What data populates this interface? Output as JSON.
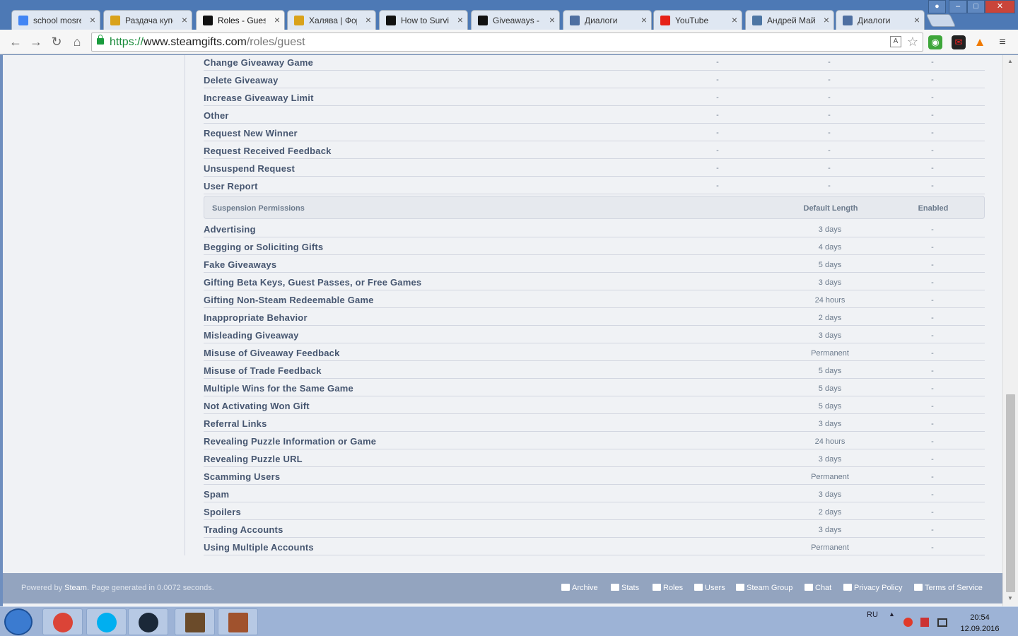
{
  "browser": {
    "tabs": [
      {
        "title": "school mosreg",
        "icon": "google-icon",
        "color": "#4285f4"
      },
      {
        "title": "Раздача купо",
        "icon": "forum-icon",
        "color": "#d9a21b"
      },
      {
        "title": "Roles - Guest",
        "icon": "steamgifts-icon",
        "color": "#111111"
      },
      {
        "title": "Халява | Фору",
        "icon": "forum-icon",
        "color": "#d9a21b"
      },
      {
        "title": "How to Surviv",
        "icon": "steamgifts-icon",
        "color": "#111111"
      },
      {
        "title": "Giveaways - W",
        "icon": "steamgifts-icon",
        "color": "#111111"
      },
      {
        "title": "Диалоги",
        "icon": "chat-icon",
        "color": "#4e6fa1"
      },
      {
        "title": "YouTube",
        "icon": "youtube-icon",
        "color": "#e62117"
      },
      {
        "title": "Андрей Майс",
        "icon": "vk-icon",
        "color": "#4c75a3"
      },
      {
        "title": "Диалоги",
        "icon": "chat-icon",
        "color": "#4e6fa1"
      }
    ],
    "url": {
      "scheme": "https://",
      "host": "www.steamgifts.com",
      "path": "/roles/guest"
    }
  },
  "action_rows": [
    {
      "name": "Change Giveaway Game",
      "c1": "-",
      "c2": "-",
      "c3": "-"
    },
    {
      "name": "Delete Giveaway",
      "c1": "-",
      "c2": "-",
      "c3": "-"
    },
    {
      "name": "Increase Giveaway Limit",
      "c1": "-",
      "c2": "-",
      "c3": "-"
    },
    {
      "name": "Other",
      "c1": "-",
      "c2": "-",
      "c3": "-"
    },
    {
      "name": "Request New Winner",
      "c1": "-",
      "c2": "-",
      "c3": "-"
    },
    {
      "name": "Request Received Feedback",
      "c1": "-",
      "c2": "-",
      "c3": "-"
    },
    {
      "name": "Unsuspend Request",
      "c1": "-",
      "c2": "-",
      "c3": "-"
    },
    {
      "name": "User Report",
      "c1": "-",
      "c2": "-",
      "c3": "-"
    }
  ],
  "suspension_header": {
    "title": "Suspension Permissions",
    "length": "Default Length",
    "enabled": "Enabled"
  },
  "suspension_rows": [
    {
      "name": "Advertising",
      "length": "3 days",
      "enabled": "-"
    },
    {
      "name": "Begging or Soliciting Gifts",
      "length": "4 days",
      "enabled": "-"
    },
    {
      "name": "Fake Giveaways",
      "length": "5 days",
      "enabled": "-"
    },
    {
      "name": "Gifting Beta Keys, Guest Passes, or Free Games",
      "length": "3 days",
      "enabled": "-"
    },
    {
      "name": "Gifting Non-Steam Redeemable Game",
      "length": "24 hours",
      "enabled": "-"
    },
    {
      "name": "Inappropriate Behavior",
      "length": "2 days",
      "enabled": "-"
    },
    {
      "name": "Misleading Giveaway",
      "length": "3 days",
      "enabled": "-"
    },
    {
      "name": "Misuse of Giveaway Feedback",
      "length": "Permanent",
      "enabled": "-"
    },
    {
      "name": "Misuse of Trade Feedback",
      "length": "5 days",
      "enabled": "-"
    },
    {
      "name": "Multiple Wins for the Same Game",
      "length": "5 days",
      "enabled": "-"
    },
    {
      "name": "Not Activating Won Gift",
      "length": "5 days",
      "enabled": "-"
    },
    {
      "name": "Referral Links",
      "length": "3 days",
      "enabled": "-"
    },
    {
      "name": "Revealing Puzzle Information or Game",
      "length": "24 hours",
      "enabled": "-"
    },
    {
      "name": "Revealing Puzzle URL",
      "length": "3 days",
      "enabled": "-"
    },
    {
      "name": "Scamming Users",
      "length": "Permanent",
      "enabled": "-"
    },
    {
      "name": "Spam",
      "length": "3 days",
      "enabled": "-"
    },
    {
      "name": "Spoilers",
      "length": "2 days",
      "enabled": "-"
    },
    {
      "name": "Trading Accounts",
      "length": "3 days",
      "enabled": "-"
    },
    {
      "name": "Using Multiple Accounts",
      "length": "Permanent",
      "enabled": "-"
    }
  ],
  "footer": {
    "powered_prefix": "Powered by ",
    "powered_link": "Steam",
    "generated": ". Page generated in 0.0072 seconds.",
    "links": [
      {
        "label": "Archive",
        "icon": "folder-icon"
      },
      {
        "label": "Stats",
        "icon": "bar-chart-icon"
      },
      {
        "label": "Roles",
        "icon": "wrench-icon"
      },
      {
        "label": "Users",
        "icon": "user-icon"
      },
      {
        "label": "Steam Group",
        "icon": "steam-icon"
      },
      {
        "label": "Chat",
        "icon": "megaphone-icon"
      },
      {
        "label": "Privacy Policy",
        "icon": "document-icon"
      },
      {
        "label": "Terms of Service",
        "icon": "gavel-icon"
      }
    ]
  },
  "taskbar": {
    "apps": [
      {
        "name": "chrome",
        "color": "#db4437"
      },
      {
        "name": "skype",
        "color": "#00aff0"
      },
      {
        "name": "steam",
        "color": "#1b2838"
      },
      {
        "name": "game-1",
        "color": "#6b4b2a"
      },
      {
        "name": "game-2",
        "color": "#a0522d"
      }
    ],
    "lang": "RU",
    "time": "20:54",
    "date": "12.09.2016"
  }
}
